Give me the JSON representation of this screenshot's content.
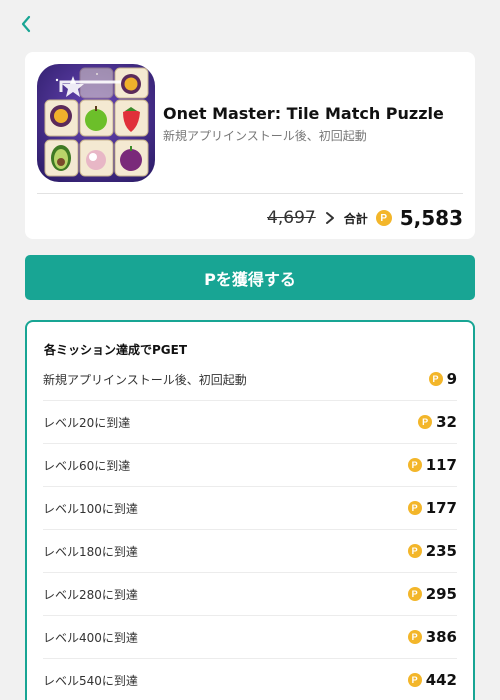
{
  "nav": {
    "back_icon": "chevron-left-icon",
    "accent": "#18a594"
  },
  "app": {
    "name": "Onet Master: Tile Match Puzzle",
    "condition": "新規アプリインストール後、初回起動",
    "icon": "tile-puzzle-app-icon"
  },
  "price": {
    "old": "4,697",
    "total_label": "合計",
    "total": "5,583",
    "coin_symbol": "P",
    "coin_color": "#f3b62a"
  },
  "cta": {
    "label": "Pを獲得する",
    "color": "#18a594"
  },
  "missions": {
    "title": "各ミッション達成でPGET",
    "items": [
      {
        "label": "新規アプリインストール後、初回起動",
        "points": "9"
      },
      {
        "label": "レベル20に到達",
        "points": "32"
      },
      {
        "label": "レベル60に到達",
        "points": "117"
      },
      {
        "label": "レベル100に到達",
        "points": "177"
      },
      {
        "label": "レベル180に到達",
        "points": "235"
      },
      {
        "label": "レベル280に到達",
        "points": "295"
      },
      {
        "label": "レベル400に到達",
        "points": "386"
      },
      {
        "label": "レベル540に到達",
        "points": "442"
      }
    ]
  }
}
